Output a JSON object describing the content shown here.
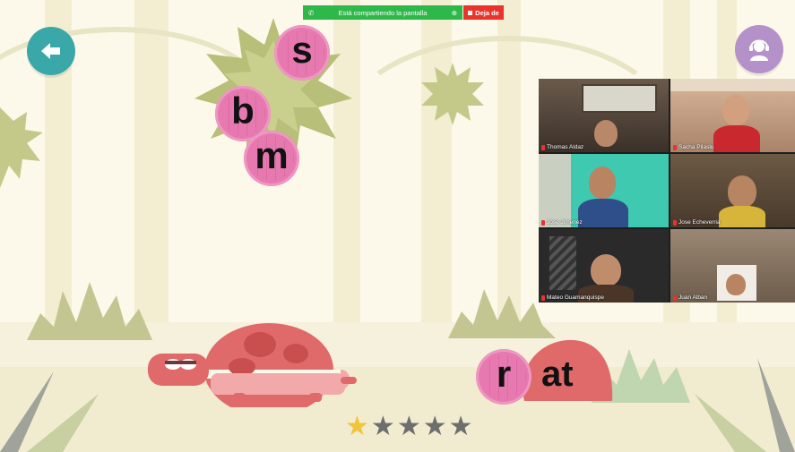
{
  "screen_share": {
    "status_text": "Está compartiendo la pantalla",
    "stop_label": "Deja de"
  },
  "game": {
    "back_icon": "arrow-left-icon",
    "help_icon": "headset-icon",
    "letter_choices": [
      "s",
      "b",
      "m"
    ],
    "selected_letter": "r",
    "word_ending": "at",
    "stars": {
      "filled": 1,
      "total": 5
    },
    "colors": {
      "bubble": "#e67ab0",
      "back_button": "#3aa7a8",
      "help_button": "#b491c8",
      "turtle": "#e06a6a",
      "star_filled": "#f2c43a",
      "star_empty": "#6e6e6e"
    }
  },
  "participants": [
    {
      "name": "Thomas Aldaz"
    },
    {
      "name": "Sacha Pilaslu"
    },
    {
      "name": "Jose Jimenez"
    },
    {
      "name": "Jose Echeverria"
    },
    {
      "name": "Mateo Guamanquispe"
    },
    {
      "name": "Juan Alban"
    }
  ]
}
